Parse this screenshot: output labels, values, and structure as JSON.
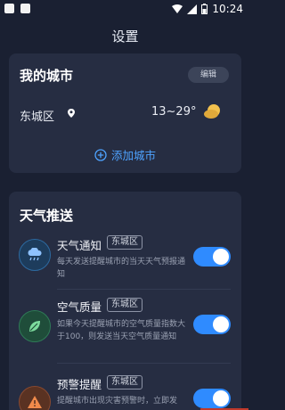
{
  "status_bar": {
    "time": "10:24"
  },
  "header": {
    "title": "设置"
  },
  "my_city": {
    "title": "我的城市",
    "edit_label": "编辑",
    "city": "东城区",
    "temperature": "13~29°",
    "weather_icon": "sunny-cloudy-icon",
    "add_city_label": "添加城市"
  },
  "push": {
    "title": "天气推送",
    "items": [
      {
        "title": "天气通知",
        "tag": "东城区",
        "desc": "每天发送提醒城市的当天天气预报通知",
        "enabled": true,
        "icon": "cloud-rain-icon",
        "icon_color": "#1d3c5c"
      },
      {
        "title": "空气质量",
        "tag": "东城区",
        "desc": "如果今天提醒城市的空气质量指数大于100，则发送当天空气质量通知",
        "enabled": true,
        "icon": "leaf-icon",
        "icon_color": "#1f4d3a"
      },
      {
        "title": "预警提醒",
        "tag": "东城区",
        "desc": "提醒城市出现灾害预警时，立即发",
        "enabled": true,
        "icon": "warning-triangle-icon",
        "icon_color": "#5a3222"
      }
    ]
  },
  "colors": {
    "accent": "#2f8bff",
    "background": "#1a2032",
    "card": "#262d42"
  }
}
